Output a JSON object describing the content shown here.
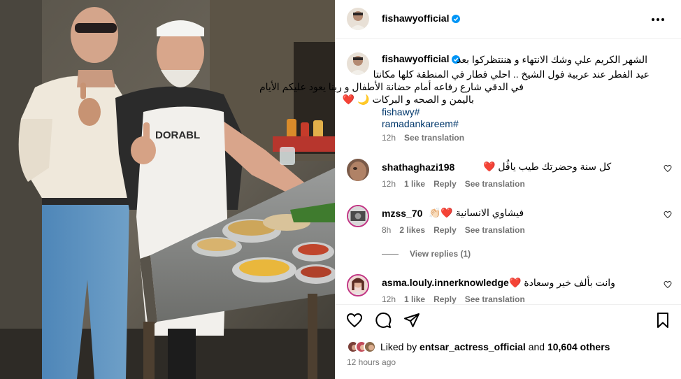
{
  "post": {
    "username": "fishawyofficial",
    "verified": true
  },
  "caption": {
    "username": "fishawyofficial",
    "lines": [
      "الشهر الكريم علي وشك الانتهاء و هننتظركوا بعد",
      "عيد الفطر عند عربية فول الشيخ .. احلي فطار في المنطقة كلها مكانتا",
      "في الدقي شارع رفاعه أمام حضانة الأطفال و ربنا يعود عليكم الأيام",
      "باليمن و الصحه و البركات 🌙 ❤️"
    ],
    "hashtags": [
      "fishawy#",
      "ramadankareem#"
    ],
    "time": "12h",
    "see_translation": "See translation"
  },
  "comments": [
    {
      "username": "shathaghazi198",
      "text": "كل سنة وحضرتك طيب ياڤُل ❤️",
      "time": "12h",
      "likes": "1 like",
      "reply": "Reply",
      "see_translation": "See translation"
    },
    {
      "username": "mzss_70",
      "text": "فيشاوي الانسانية ❤️👏🏻",
      "time": "8h",
      "likes": "2 likes",
      "reply": "Reply",
      "see_translation": "See translation"
    },
    {
      "username": "asma.louly.innerknowledge",
      "text": "وانت بألف خير وسعادة ❤️",
      "time": "12h",
      "likes": "1 like",
      "reply": "Reply",
      "see_translation": "See translation"
    }
  ],
  "view_replies": "View replies (1)",
  "likes": {
    "prefix": "Liked by",
    "user": "entsar_actress_official",
    "middle": "and",
    "count": "10,604 others"
  },
  "time_ago": "12 hours ago",
  "photo": {
    "apron_text": "DORABL"
  },
  "icons": {
    "like": "heart-icon",
    "comment": "comment-icon",
    "share": "send-icon",
    "save": "bookmark-icon",
    "more": "more-icon",
    "verified": "verified-badge-icon"
  },
  "colors": {
    "verified": "#0095f6",
    "link": "#00376b",
    "meta": "#737373"
  }
}
